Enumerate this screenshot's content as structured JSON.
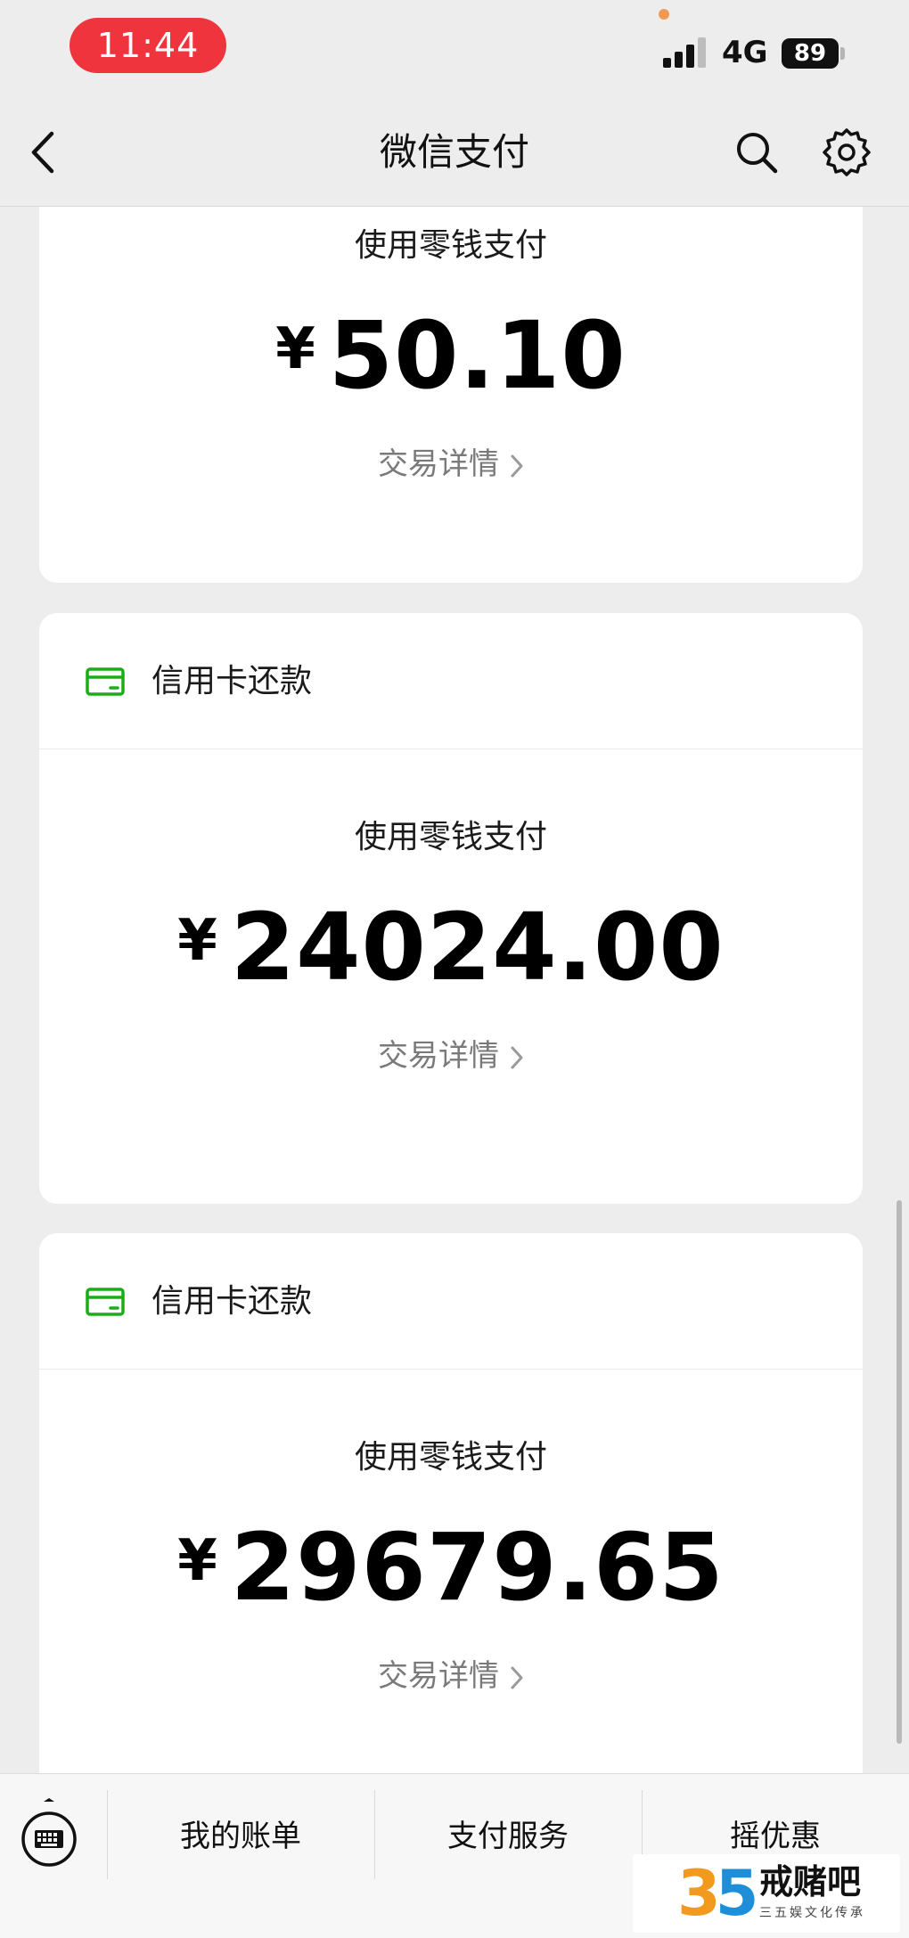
{
  "status_bar": {
    "time": "11:44",
    "network": "4G",
    "battery": "89"
  },
  "nav": {
    "title": "微信支付",
    "icons": [
      "chevron-left-icon",
      "search-icon",
      "gear-icon"
    ]
  },
  "cards": [
    {
      "type_label": "",
      "pay_method": "使用零钱支付",
      "currency": "¥",
      "amount": "50.10",
      "detail_link": "交易详情"
    },
    {
      "type_label": "信用卡还款",
      "pay_method": "使用零钱支付",
      "currency": "¥",
      "amount": "24024.00",
      "detail_link": "交易详情"
    },
    {
      "type_label": "信用卡还款",
      "pay_method": "使用零钱支付",
      "currency": "¥",
      "amount": "29679.65",
      "detail_link": "交易详情"
    }
  ],
  "bottom_bar": {
    "tabs": [
      "我的账单",
      "支付服务",
      "摇优惠"
    ]
  },
  "watermark": {
    "logo": "35",
    "name": "戒赌吧",
    "subtitle": "三五娱文化传承"
  },
  "colors": {
    "time_pill": "#f0343d",
    "card_icon": "#1aad19",
    "background": "#ededed"
  }
}
